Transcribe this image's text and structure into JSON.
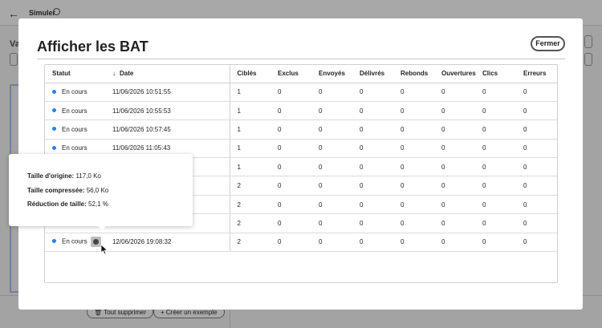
{
  "background": {
    "page_title": "Simuler",
    "left_label": "Va",
    "delete_all_label": "Tout supprimer",
    "create_example_label": "Créer un exemple"
  },
  "modal": {
    "title": "Afficher les BAT",
    "close_label": "Fermer",
    "columns": [
      "Statut",
      "Date",
      "Ciblés",
      "Exclus",
      "Envoyés",
      "Délivrés",
      "Rebonds",
      "Ouvertures",
      "Clics",
      "Erreurs"
    ],
    "sort_column": "Date",
    "rows": [
      {
        "status": "En cours",
        "date": "11/06/2026 10:51:55",
        "cibles": "1",
        "exclus": "0",
        "envoyes": "0",
        "delivres": "0",
        "rebonds": "0",
        "ouvertures": "0",
        "clics": "0",
        "erreurs": "0"
      },
      {
        "status": "En cours",
        "date": "11/06/2026 10:55:53",
        "cibles": "1",
        "exclus": "0",
        "envoyes": "0",
        "delivres": "0",
        "rebonds": "0",
        "ouvertures": "0",
        "clics": "0",
        "erreurs": "0"
      },
      {
        "status": "En cours",
        "date": "11/06/2026 10:57:45",
        "cibles": "1",
        "exclus": "0",
        "envoyes": "0",
        "delivres": "0",
        "rebonds": "0",
        "ouvertures": "0",
        "clics": "0",
        "erreurs": "0"
      },
      {
        "status": "En cours",
        "date": "11/06/2026 11:05:43",
        "cibles": "1",
        "exclus": "0",
        "envoyes": "0",
        "delivres": "0",
        "rebonds": "0",
        "ouvertures": "0",
        "clics": "0",
        "erreurs": "0"
      },
      {
        "status": "",
        "date": "",
        "cibles": "1",
        "exclus": "0",
        "envoyes": "0",
        "delivres": "0",
        "rebonds": "0",
        "ouvertures": "0",
        "clics": "0",
        "erreurs": "0"
      },
      {
        "status": "",
        "date": "",
        "cibles": "2",
        "exclus": "0",
        "envoyes": "0",
        "delivres": "0",
        "rebonds": "0",
        "ouvertures": "0",
        "clics": "0",
        "erreurs": "0"
      },
      {
        "status": "",
        "date": "",
        "cibles": "2",
        "exclus": "0",
        "envoyes": "0",
        "delivres": "0",
        "rebonds": "0",
        "ouvertures": "0",
        "clics": "0",
        "erreurs": "0"
      },
      {
        "status": "",
        "date": "",
        "cibles": "2",
        "exclus": "0",
        "envoyes": "0",
        "delivres": "0",
        "rebonds": "0",
        "ouvertures": "0",
        "clics": "0",
        "erreurs": "0"
      },
      {
        "status": "En cours",
        "date": "12/06/2026 19:08:32",
        "cibles": "2",
        "exclus": "0",
        "envoyes": "0",
        "delivres": "0",
        "rebonds": "0",
        "ouvertures": "0",
        "clics": "0",
        "erreurs": "0",
        "has_info": true
      }
    ]
  },
  "tooltip": {
    "original_size_label": "Taille d'origine:",
    "original_size_value": "117,0 Ko",
    "compressed_size_label": "Taille compressée:",
    "compressed_size_value": "56,0 Ko",
    "reduction_label": "Réduction de taille:",
    "reduction_value": "52,1 %"
  },
  "colors": {
    "status_dot": "#2680eb",
    "overlay": "#a3a3a3"
  },
  "icons": {
    "back": "arrow-left-icon",
    "info": "info-icon",
    "sort": "arrow-down-icon",
    "delete": "trash-icon",
    "add": "plus-icon"
  }
}
